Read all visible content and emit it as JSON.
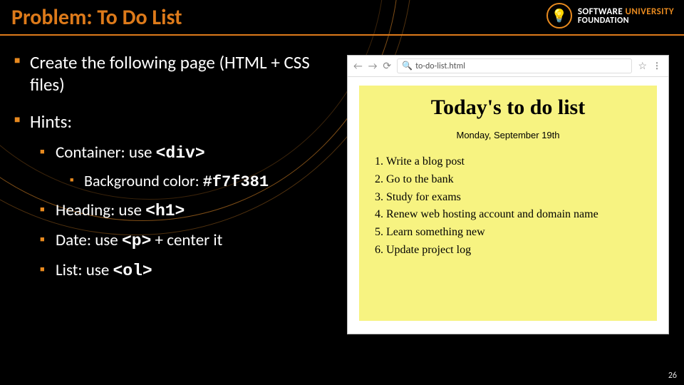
{
  "title": "Problem: To Do List",
  "logo": {
    "line1a": "SOFTWARE",
    "line1b": "UNIVERSITY",
    "line2": "FOUNDATION"
  },
  "bullets": {
    "create": "Create the following page (HTML + CSS files)",
    "hints": "Hints:",
    "container_pre": "Container: use ",
    "container_tag": "<div>",
    "bg_pre": "Background color: ",
    "bg_val": "#f7f381",
    "heading_pre": "Heading: use ",
    "heading_tag": "<h1>",
    "date_pre": "Date: use ",
    "date_tag": "<p>",
    "date_post": " + center it",
    "list_pre": "List: use ",
    "list_tag": "<ol>"
  },
  "browser": {
    "url": "to-do-list.html",
    "note_heading": "Today's to do list",
    "note_date": "Monday, September 19th",
    "items": [
      "Write a blog post",
      "Go to the bank",
      "Study for exams",
      "Renew web hosting account and domain name",
      "Learn something new",
      "Update project log"
    ]
  },
  "page_number": "26"
}
